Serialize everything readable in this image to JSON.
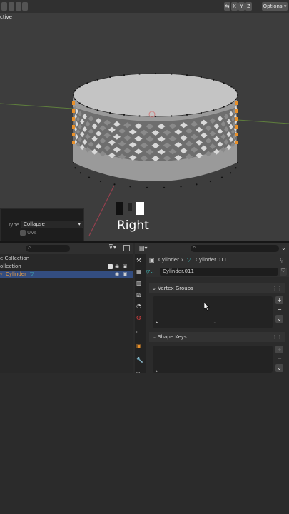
{
  "viewport": {
    "mode_label": "ctive",
    "axis_buttons": [
      "X",
      "Y",
      "Z"
    ],
    "options_label": "Options"
  },
  "operator_panel": {
    "type_label": "Type",
    "type_value": "Collapse",
    "uvs_label": "UVs"
  },
  "overlay_text": "Right",
  "outliner": {
    "rows": [
      {
        "label": "e Collection"
      },
      {
        "label": "ollection"
      },
      {
        "label": "Cylinder"
      }
    ]
  },
  "properties": {
    "breadcrumb_object": "Cylinder",
    "breadcrumb_mesh": "Cylinder.011",
    "mesh_name": "Cylinder.011",
    "vertex_groups_label": "Vertex Groups",
    "shape_keys_label": "Shape Keys"
  },
  "colors": {
    "accent_selected": "#334d80",
    "mesh_gray": "#c4c4c4",
    "edge_orange": "#e8902a"
  }
}
